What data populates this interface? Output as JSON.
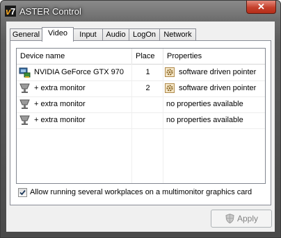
{
  "window": {
    "title": "ASTER Control",
    "close_label": "✕"
  },
  "tabs": [
    {
      "label": "General"
    },
    {
      "label": "Video"
    },
    {
      "label": "Input"
    },
    {
      "label": "Audio"
    },
    {
      "label": "LogOn"
    },
    {
      "label": "Network"
    }
  ],
  "active_tab": "Video",
  "device_list": {
    "columns": [
      "Device name",
      "Place",
      "Properties"
    ],
    "rows": [
      {
        "icon": "gpu-card-icon",
        "name": "NVIDIA GeForce GTX 970",
        "place": "1",
        "properties_icon": "settings-gear-icon",
        "properties": "software driven pointer"
      },
      {
        "icon": "monitor-icon",
        "name": "+ extra monitor",
        "place": "2",
        "properties_icon": "settings-gear-icon",
        "properties": "software driven pointer"
      },
      {
        "icon": "monitor-icon",
        "name": "+ extra monitor",
        "place": "",
        "properties_icon": "",
        "properties": "no properties available"
      },
      {
        "icon": "monitor-icon",
        "name": "+ extra monitor",
        "place": "",
        "properties_icon": "",
        "properties": "no properties available"
      }
    ]
  },
  "multimonitor": {
    "label": "Allow running several workplaces on a multimonitor graphics card",
    "checked": true
  },
  "apply_button": {
    "label": "Apply",
    "enabled": false
  },
  "colors": {
    "close_red": "#c4402c",
    "frame_gray": "#5c5c5c",
    "panel_bg": "#f0f0f0"
  }
}
